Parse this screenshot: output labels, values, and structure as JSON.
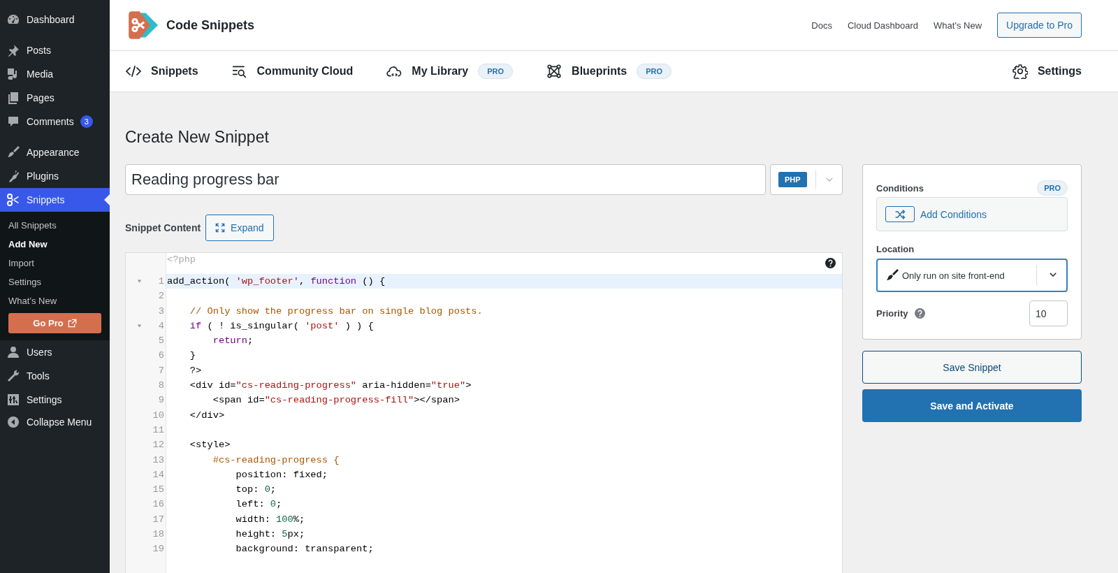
{
  "sidebar": {
    "items": [
      {
        "label": "Dashboard",
        "selected": false
      },
      {
        "label": "Posts",
        "selected": false
      },
      {
        "label": "Media",
        "selected": false
      },
      {
        "label": "Pages",
        "selected": false
      },
      {
        "label": "Comments",
        "selected": false,
        "badge": "3"
      },
      {
        "label": "Appearance",
        "selected": false
      },
      {
        "label": "Plugins",
        "selected": false
      },
      {
        "label": "Snippets",
        "selected": true,
        "submenu": [
          {
            "label": "All Snippets",
            "selected": false
          },
          {
            "label": "Add New",
            "selected": true
          },
          {
            "label": "Import",
            "selected": false
          },
          {
            "label": "Settings",
            "selected": false
          },
          {
            "label": "What’s New",
            "selected": false
          }
        ],
        "go_pro": "Go Pro"
      },
      {
        "label": "Users",
        "selected": false
      },
      {
        "label": "Tools",
        "selected": false
      },
      {
        "label": "Settings",
        "selected": false
      }
    ],
    "collapse": "Collapse Menu"
  },
  "header": {
    "brand": "Code Snippets",
    "links": [
      "Docs",
      "Cloud Dashboard",
      "What's New"
    ],
    "upgrade": "Upgrade to Pro"
  },
  "nav": {
    "tabs": [
      {
        "label": "Snippets"
      },
      {
        "label": "Community Cloud"
      },
      {
        "label": "My Library",
        "badge": "PRO"
      },
      {
        "label": "Blueprints",
        "badge": "PRO"
      }
    ],
    "settings": "Settings"
  },
  "main": {
    "title": "Create New Snippet",
    "snippet_name": "Reading progress bar",
    "language": "PHP",
    "content_label": "Snippet Content",
    "expand": "Expand",
    "editor": {
      "opening": "<?php",
      "lines": [
        {
          "number": "1",
          "fold": true,
          "active": true,
          "tokens": [
            {
              "kind": "plain",
              "text": "add_action( "
            },
            {
              "kind": "string",
              "text": "'wp_footer'"
            },
            {
              "kind": "plain",
              "text": ", "
            },
            {
              "kind": "keyword",
              "text": "function"
            },
            {
              "kind": "plain",
              "text": " () {"
            }
          ]
        },
        {
          "number": "2",
          "fold": false,
          "active": false
        },
        {
          "number": "3",
          "fold": false,
          "active": false,
          "tokens": [
            {
              "kind": "comment",
              "text": "    // Only show the progress bar on single blog posts."
            }
          ]
        },
        {
          "number": "4",
          "fold": true,
          "active": false,
          "tokens": [
            {
              "kind": "keyword",
              "text": "    if"
            },
            {
              "kind": "plain",
              "text": " ( ! is_singular( "
            },
            {
              "kind": "string",
              "text": "'post'"
            },
            {
              "kind": "plain",
              "text": " ) ) {"
            }
          ]
        },
        {
          "number": "5",
          "fold": false,
          "active": false,
          "tokens": [
            {
              "kind": "keyword",
              "text": "        return"
            },
            {
              "kind": "plain",
              "text": ";"
            }
          ]
        },
        {
          "number": "6",
          "fold": false,
          "active": false,
          "tokens": [
            {
              "kind": "plain",
              "text": "    }"
            }
          ]
        },
        {
          "number": "7",
          "fold": false,
          "active": false,
          "tokens": [
            {
              "kind": "plain",
              "text": "    ?>"
            }
          ]
        },
        {
          "number": "8",
          "fold": false,
          "active": false,
          "tokens": [
            {
              "kind": "plain",
              "text": "    <div id="
            },
            {
              "kind": "string",
              "text": "\"cs-reading-progress\""
            },
            {
              "kind": "plain",
              "text": " aria-hidden="
            },
            {
              "kind": "string",
              "text": "\"true\""
            },
            {
              "kind": "plain",
              "text": ">"
            }
          ]
        },
        {
          "number": "9",
          "fold": false,
          "active": false,
          "tokens": [
            {
              "kind": "plain",
              "text": "        <span id="
            },
            {
              "kind": "string",
              "text": "\"cs-reading-progress-fill\""
            },
            {
              "kind": "plain",
              "text": "></span>"
            }
          ]
        },
        {
          "number": "10",
          "fold": false,
          "active": false,
          "tokens": [
            {
              "kind": "plain",
              "text": "    </div>"
            }
          ]
        },
        {
          "number": "11",
          "fold": false,
          "active": false
        },
        {
          "number": "12",
          "fold": false,
          "active": false,
          "tokens": [
            {
              "kind": "plain",
              "text": "    <style>"
            }
          ]
        },
        {
          "number": "13",
          "fold": false,
          "active": false,
          "tokens": [
            {
              "kind": "selector",
              "text": "        #cs-reading-progress {"
            }
          ]
        },
        {
          "number": "14",
          "fold": false,
          "active": false,
          "tokens": [
            {
              "kind": "plain",
              "text": "            position: fixed;"
            }
          ]
        },
        {
          "number": "15",
          "fold": false,
          "active": false,
          "tokens": [
            {
              "kind": "plain",
              "text": "            top: "
            },
            {
              "kind": "number",
              "text": "0"
            },
            {
              "kind": "plain",
              "text": ";"
            }
          ]
        },
        {
          "number": "16",
          "fold": false,
          "active": false,
          "tokens": [
            {
              "kind": "plain",
              "text": "            left: "
            },
            {
              "kind": "number",
              "text": "0"
            },
            {
              "kind": "plain",
              "text": ";"
            }
          ]
        },
        {
          "number": "17",
          "fold": false,
          "active": false,
          "tokens": [
            {
              "kind": "plain",
              "text": "            width: "
            },
            {
              "kind": "number",
              "text": "100"
            },
            {
              "kind": "plain",
              "text": "%;"
            }
          ]
        },
        {
          "number": "18",
          "fold": false,
          "active": false,
          "tokens": [
            {
              "kind": "plain",
              "text": "            height: "
            },
            {
              "kind": "number",
              "text": "5"
            },
            {
              "kind": "plain",
              "text": "px;"
            }
          ]
        },
        {
          "number": "19",
          "fold": false,
          "active": false,
          "tokens": [
            {
              "kind": "plain",
              "text": "            background: transparent;"
            }
          ]
        }
      ]
    }
  },
  "panel": {
    "conditions_label": "Conditions",
    "conditions_badge": "PRO",
    "add_conditions": "Add Conditions",
    "location_label": "Location",
    "location": "Only run on site front-end",
    "priority_label": "Priority",
    "priority": "10",
    "save": "Save Snippet",
    "activate": "Save and Activate"
  }
}
